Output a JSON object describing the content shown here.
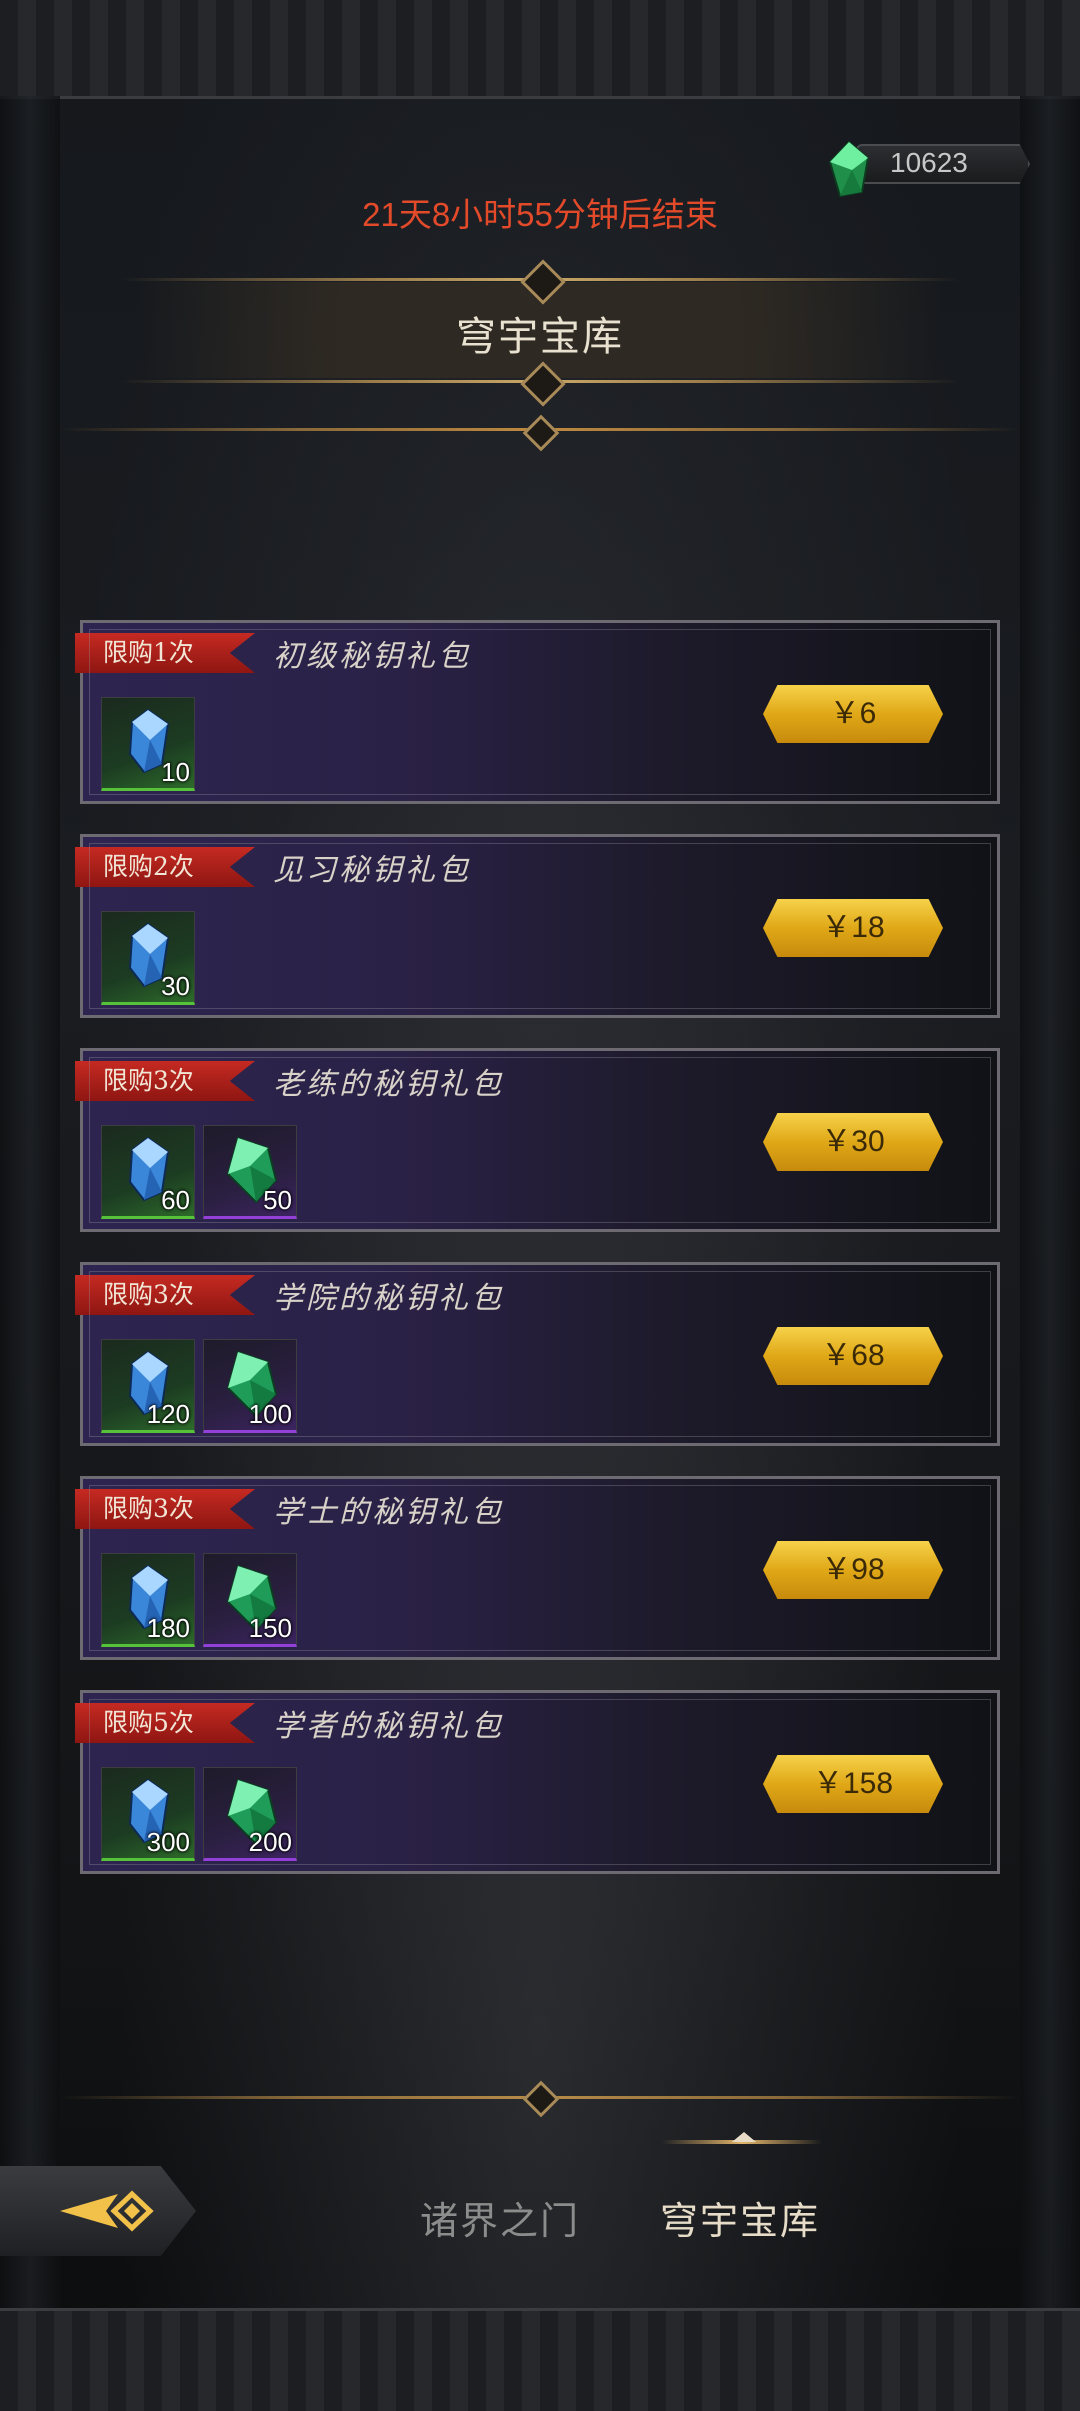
{
  "currency": {
    "amount": "10623",
    "icon": "green-crystal-icon"
  },
  "timer": "21天8小时55分钟后结束",
  "title": "穹宇宝库",
  "packs": [
    {
      "limit": "限购1次",
      "name": "初级秘钥礼包",
      "price": "￥6",
      "items": [
        {
          "type": "blue-key",
          "qty": "10"
        }
      ]
    },
    {
      "limit": "限购2次",
      "name": "见习秘钥礼包",
      "price": "￥18",
      "items": [
        {
          "type": "blue-key",
          "qty": "30"
        }
      ]
    },
    {
      "limit": "限购3次",
      "name": "老练的秘钥礼包",
      "price": "￥30",
      "items": [
        {
          "type": "blue-key",
          "qty": "60"
        },
        {
          "type": "green-crystal",
          "qty": "50"
        }
      ]
    },
    {
      "limit": "限购3次",
      "name": "学院的秘钥礼包",
      "price": "￥68",
      "items": [
        {
          "type": "blue-key",
          "qty": "120"
        },
        {
          "type": "green-crystal",
          "qty": "100"
        }
      ]
    },
    {
      "limit": "限购3次",
      "name": "学士的秘钥礼包",
      "price": "￥98",
      "items": [
        {
          "type": "blue-key",
          "qty": "180"
        },
        {
          "type": "green-crystal",
          "qty": "150"
        }
      ]
    },
    {
      "limit": "限购5次",
      "name": "学者的秘钥礼包",
      "price": "￥158",
      "items": [
        {
          "type": "blue-key",
          "qty": "300"
        },
        {
          "type": "green-crystal",
          "qty": "200"
        }
      ]
    }
  ],
  "nav": {
    "tabs": [
      {
        "label": "诸界之门",
        "active": false
      },
      {
        "label": "穹宇宝库",
        "active": true
      }
    ],
    "back_icon": "back-arrow-icon"
  },
  "colors": {
    "timer": "#e24a2a",
    "price_button": "#e0a817",
    "limit_tag": "#c52a22"
  }
}
